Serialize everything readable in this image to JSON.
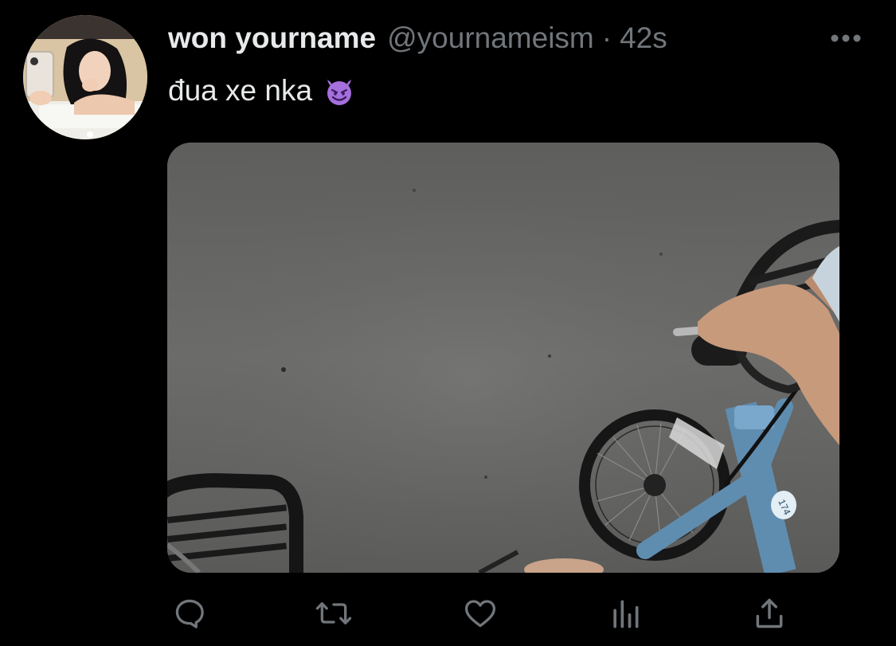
{
  "tweet": {
    "display_name": "won yourname",
    "handle": "@yournameism",
    "separator": "·",
    "time": "42s",
    "text": "đua xe nka",
    "emoji": "smiling-face-with-horns",
    "bike_number": "174"
  },
  "icons": {
    "more": "more-horizontal-icon",
    "reply": "reply-icon",
    "retweet": "retweet-icon",
    "like": "heart-icon",
    "views": "views-chart-icon",
    "share": "share-icon"
  },
  "colors": {
    "background": "#000000",
    "primary_text": "#e7e9ea",
    "secondary_text": "#71767b",
    "emoji_purple": "#a56fdc"
  }
}
